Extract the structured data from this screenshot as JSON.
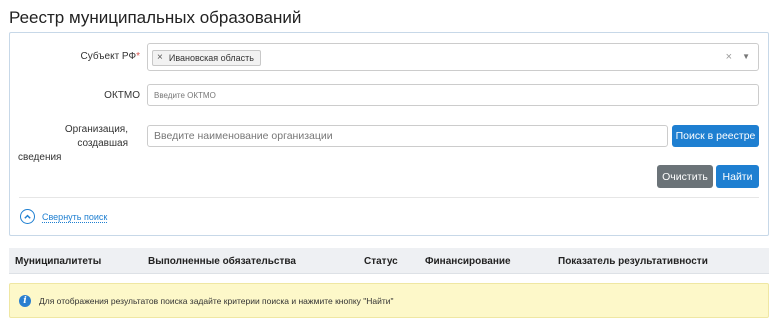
{
  "page": {
    "title": "Реестр муниципальных образований"
  },
  "search": {
    "subject": {
      "label": "Субъект РФ",
      "required_mark": "*",
      "selected_chip": "Ивановская область",
      "chip_remove_glyph": "×",
      "clear_glyph": "×",
      "caret_glyph": "▼"
    },
    "oktmo": {
      "label": "ОКТМО",
      "placeholder": "Введите ОКТМО",
      "value": ""
    },
    "organization": {
      "label_line1": "Организация, создавшая",
      "label_line2": "сведения",
      "placeholder": "Введите наименование организации",
      "value": ""
    },
    "registry_search_button": "Поиск в реестре",
    "clear_button": "Очистить",
    "find_button": "Найти",
    "collapse_link": "Свернуть поиск"
  },
  "results": {
    "columns": [
      "Муниципалитеты",
      "Выполненные обязательства",
      "Статус",
      "Финансирование",
      "Показатель результативности"
    ]
  },
  "info": {
    "icon": "info-icon",
    "message": "Для отображения результатов поиска задайте критерии поиска и нажмите кнопку \"Найти\""
  },
  "colors": {
    "accent": "#1e7fd1",
    "button_gray": "#6b7378",
    "required": "#d9534f",
    "info_background": "#fdf8c9",
    "header_background": "#eef0f3"
  }
}
